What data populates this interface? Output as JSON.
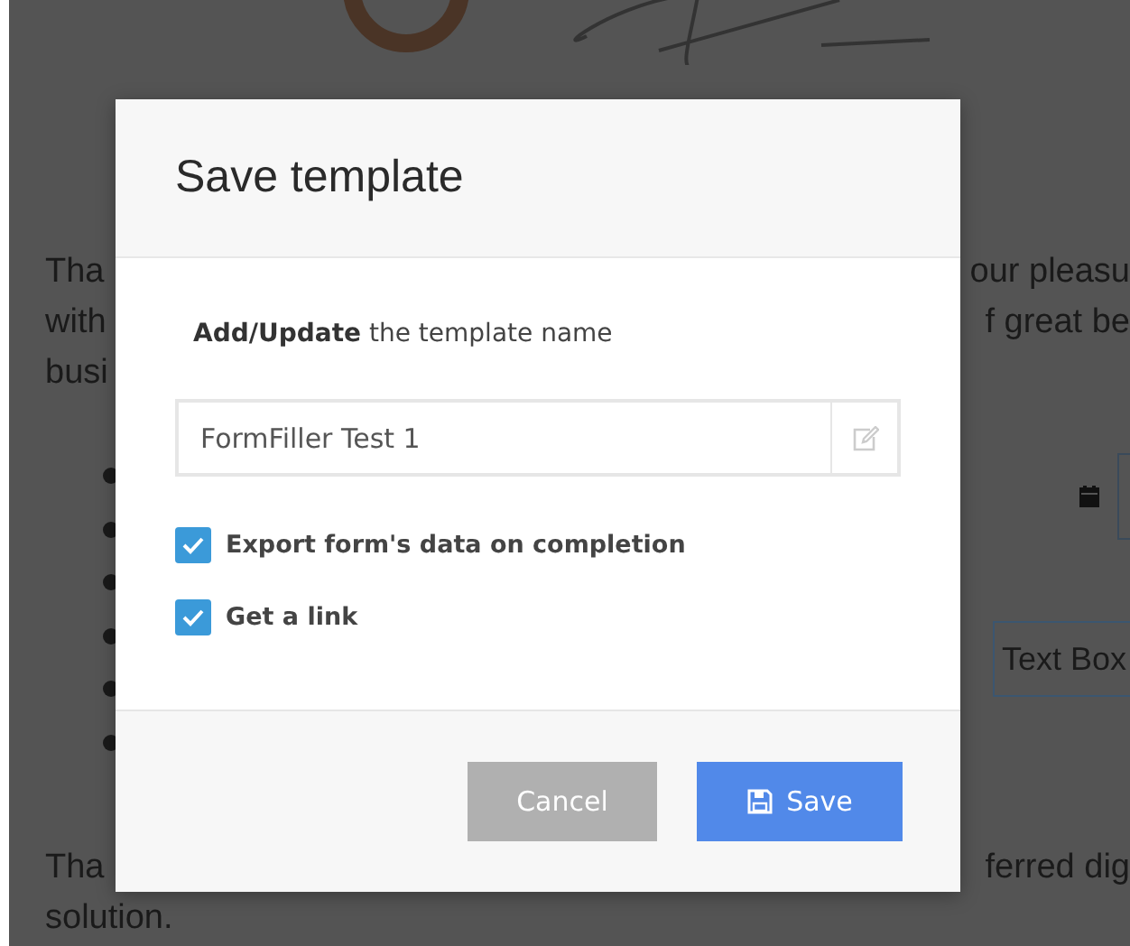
{
  "document": {
    "paragraph_1": [
      {
        "left": "Tha",
        "right": "our pleasu"
      },
      {
        "left": "with",
        "right": "f great be"
      },
      {
        "left": "busi"
      }
    ],
    "text_box": {
      "value": "Text Box"
    },
    "paragraph_2": [
      {
        "left": "Tha",
        "right": "ferred dig"
      },
      {
        "left": "solution."
      }
    ]
  },
  "dialog": {
    "title": "Save template",
    "label": "**Add/Update** the template name",
    "name_field": {
      "value": "FormFiller Test 1"
    },
    "options": [
      {
        "label": "Export form's data on completion",
        "checked": true
      },
      {
        "label": "Get a link",
        "checked": true
      }
    ],
    "buttons": [
      {
        "kind": "secondary",
        "label": "Cancel",
        "disabled": true
      },
      {
        "kind": "primary",
        "label": "Save",
        "disabled": false
      }
    ]
  }
}
